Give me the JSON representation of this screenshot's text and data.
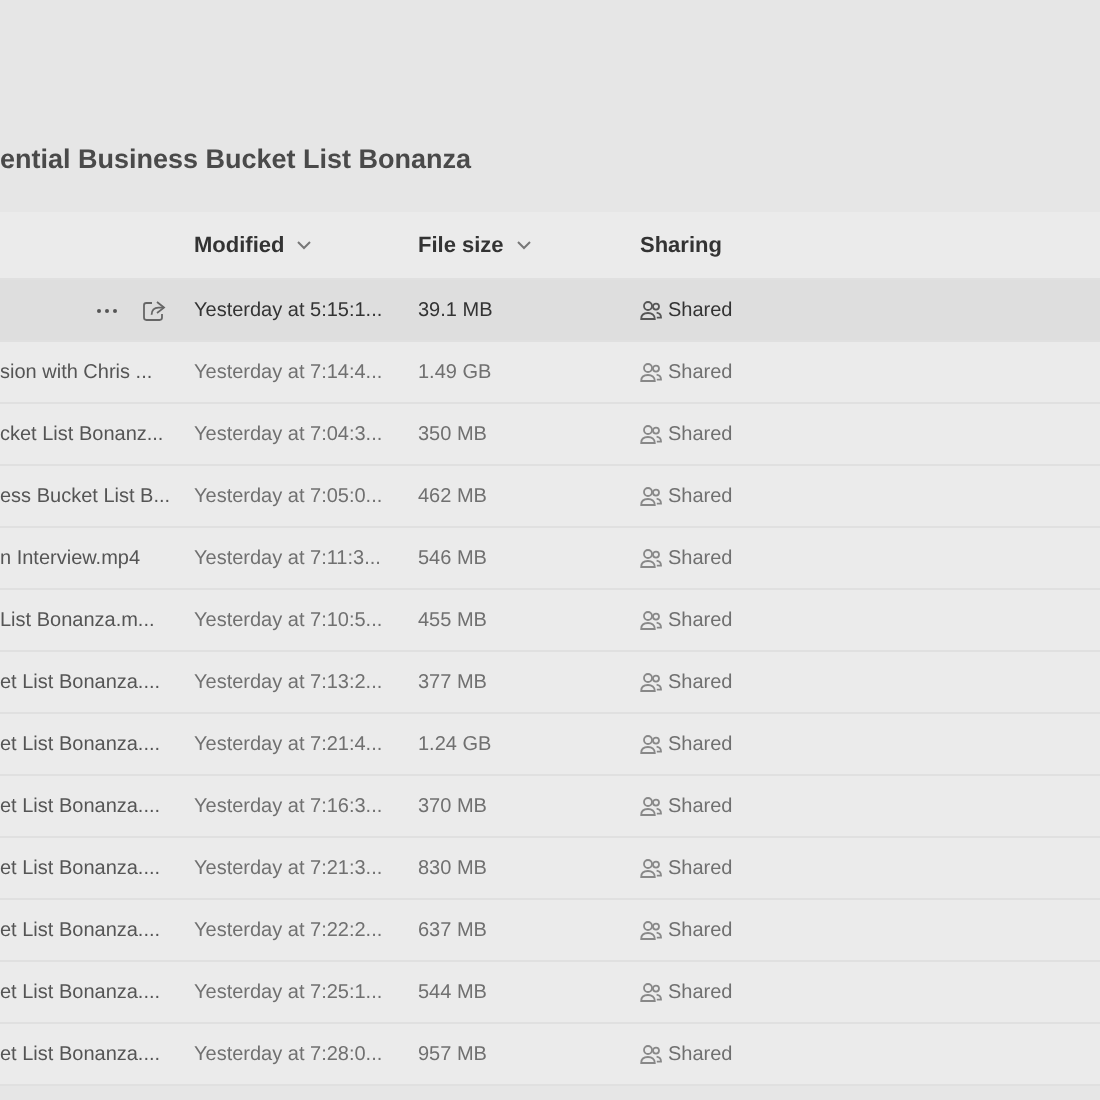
{
  "title": "ential Business Bucket List Bonanza",
  "columns": [
    {
      "label": "Modified",
      "sortable": true
    },
    {
      "label": "File size",
      "sortable": true
    },
    {
      "label": "Sharing",
      "sortable": false
    }
  ],
  "rows": [
    {
      "name": "",
      "modified": "Yesterday at 5:15:1...",
      "size": "39.1 MB",
      "sharing": "Shared",
      "hovered": true
    },
    {
      "name": "sion with Chris ...",
      "modified": "Yesterday at 7:14:4...",
      "size": "1.49 GB",
      "sharing": "Shared",
      "hovered": false
    },
    {
      "name": "cket List Bonanz...",
      "modified": "Yesterday at 7:04:3...",
      "size": "350 MB",
      "sharing": "Shared",
      "hovered": false
    },
    {
      "name": "ess Bucket List B...",
      "modified": "Yesterday at 7:05:0...",
      "size": "462 MB",
      "sharing": "Shared",
      "hovered": false
    },
    {
      "name": "n Interview.mp4",
      "modified": "Yesterday at 7:11:3...",
      "size": "546 MB",
      "sharing": "Shared",
      "hovered": false
    },
    {
      "name": "List Bonanza.m...",
      "modified": "Yesterday at 7:10:5...",
      "size": "455 MB",
      "sharing": "Shared",
      "hovered": false
    },
    {
      "name": "et List Bonanza....",
      "modified": "Yesterday at 7:13:2...",
      "size": "377 MB",
      "sharing": "Shared",
      "hovered": false
    },
    {
      "name": "et List Bonanza....",
      "modified": "Yesterday at 7:21:4...",
      "size": "1.24 GB",
      "sharing": "Shared",
      "hovered": false
    },
    {
      "name": "et List Bonanza....",
      "modified": "Yesterday at 7:16:3...",
      "size": "370 MB",
      "sharing": "Shared",
      "hovered": false
    },
    {
      "name": "et List Bonanza....",
      "modified": "Yesterday at 7:21:3...",
      "size": "830 MB",
      "sharing": "Shared",
      "hovered": false
    },
    {
      "name": "et List Bonanza....",
      "modified": "Yesterday at 7:22:2...",
      "size": "637 MB",
      "sharing": "Shared",
      "hovered": false
    },
    {
      "name": "et List Bonanza....",
      "modified": "Yesterday at 7:25:1...",
      "size": "544 MB",
      "sharing": "Shared",
      "hovered": false
    },
    {
      "name": "et List Bonanza....",
      "modified": "Yesterday at 7:28:0...",
      "size": "957 MB",
      "sharing": "Shared",
      "hovered": false
    }
  ]
}
